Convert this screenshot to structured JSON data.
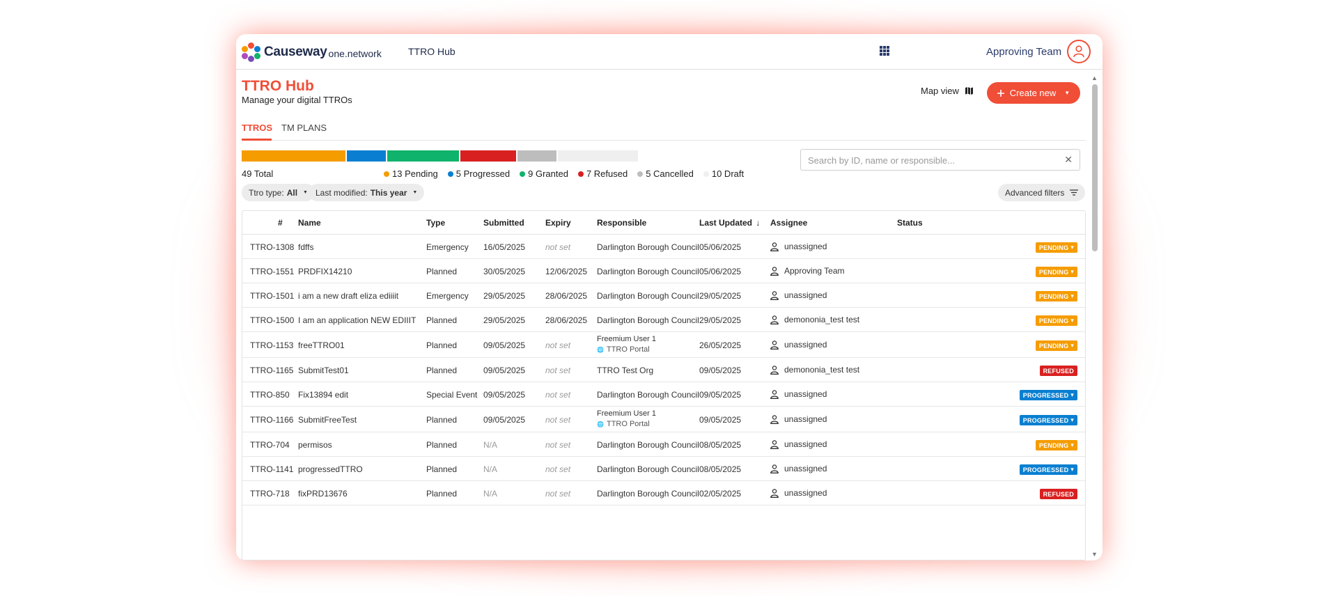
{
  "app": {
    "brand": "Causeway",
    "brand_sub": "one.network",
    "nav_link": "TTRO Hub",
    "user_label": "Approving Team"
  },
  "header": {
    "title": "TTRO Hub",
    "subtitle": "Manage your digital TTROs",
    "map_view": "Map view",
    "create_new": "Create new"
  },
  "tabs": [
    {
      "label": "TTROS",
      "active": true
    },
    {
      "label": "TM PLANS",
      "active": false
    }
  ],
  "summary": {
    "total": "49 Total",
    "segments": [
      {
        "label": "13 Pending",
        "count": 13,
        "color": "#f59c00"
      },
      {
        "label": "5 Progressed",
        "count": 5,
        "color": "#0a7fd1"
      },
      {
        "label": "9 Granted",
        "count": 9,
        "color": "#0fb36b"
      },
      {
        "label": "7 Refused",
        "count": 7,
        "color": "#d92020"
      },
      {
        "label": "5 Cancelled",
        "count": 5,
        "color": "#bdbdbd"
      },
      {
        "label": "10 Draft",
        "count": 10,
        "color": "#efefef"
      }
    ]
  },
  "search": {
    "placeholder": "Search by ID, name or responsible...",
    "value": ""
  },
  "filters": {
    "ttro_type_label": "Ttro type:",
    "ttro_type_value": "All",
    "last_modified_label": "Last modified:",
    "last_modified_value": "This year",
    "advanced": "Advanced filters"
  },
  "table": {
    "columns": [
      "#",
      "Name",
      "Type",
      "Submitted",
      "Expiry",
      "Responsible",
      "Last Updated",
      "Assignee",
      "Status"
    ],
    "rows": [
      {
        "id": "TTRO-1308",
        "name": "fdffs",
        "type": "Emergency",
        "submitted": "16/05/2025",
        "expiry": "not set",
        "responsible": "Darlington Borough Council",
        "responsible_sub": "",
        "updated": "05/06/2025",
        "assignee": "unassigned",
        "status": "PENDING"
      },
      {
        "id": "TTRO-1551",
        "name": "PRDFIX14210",
        "type": "Planned",
        "submitted": "30/05/2025",
        "expiry": "12/06/2025",
        "responsible": "Darlington Borough Council",
        "responsible_sub": "",
        "updated": "05/06/2025",
        "assignee": "Approving Team",
        "status": "PENDING"
      },
      {
        "id": "TTRO-1501",
        "name": "i am a new draft eliza ediiiit",
        "type": "Emergency",
        "submitted": "29/05/2025",
        "expiry": "28/06/2025",
        "responsible": "Darlington Borough Council",
        "responsible_sub": "",
        "updated": "29/05/2025",
        "assignee": "unassigned",
        "status": "PENDING"
      },
      {
        "id": "TTRO-1500",
        "name": "I am an application NEW EDIIIT",
        "type": "Planned",
        "submitted": "29/05/2025",
        "expiry": "28/06/2025",
        "responsible": "Darlington Borough Council",
        "responsible_sub": "",
        "updated": "29/05/2025",
        "assignee": "demononia_test test",
        "status": "PENDING"
      },
      {
        "id": "TTRO-1153",
        "name": "freeTTRO01",
        "type": "Planned",
        "submitted": "09/05/2025",
        "expiry": "not set",
        "responsible": "Freemium User 1",
        "responsible_sub": "TTRO Portal",
        "updated": "26/05/2025",
        "assignee": "unassigned",
        "status": "PENDING"
      },
      {
        "id": "TTRO-1165",
        "name": "SubmitTest01",
        "type": "Planned",
        "submitted": "09/05/2025",
        "expiry": "not set",
        "responsible": "TTRO Test Org",
        "responsible_sub": "",
        "updated": "09/05/2025",
        "assignee": "demononia_test test",
        "status": "REFUSED"
      },
      {
        "id": "TTRO-850",
        "name": "Fix13894 edit",
        "type": "Special Event",
        "submitted": "09/05/2025",
        "expiry": "not set",
        "responsible": "Darlington Borough Council",
        "responsible_sub": "",
        "updated": "09/05/2025",
        "assignee": "unassigned",
        "status": "PROGRESSED"
      },
      {
        "id": "TTRO-1166",
        "name": "SubmitFreeTest",
        "type": "Planned",
        "submitted": "09/05/2025",
        "expiry": "not set",
        "responsible": "Freemium User 1",
        "responsible_sub": "TTRO Portal",
        "updated": "09/05/2025",
        "assignee": "unassigned",
        "status": "PROGRESSED"
      },
      {
        "id": "TTRO-704",
        "name": "permisos",
        "type": "Planned",
        "submitted": "N/A",
        "expiry": "not set",
        "responsible": "Darlington Borough Council",
        "responsible_sub": "",
        "updated": "08/05/2025",
        "assignee": "unassigned",
        "status": "PENDING"
      },
      {
        "id": "TTRO-1141",
        "name": "progressedTTRO",
        "type": "Planned",
        "submitted": "N/A",
        "expiry": "not set",
        "responsible": "Darlington Borough Council",
        "responsible_sub": "",
        "updated": "08/05/2025",
        "assignee": "unassigned",
        "status": "PROGRESSED"
      },
      {
        "id": "TTRO-718",
        "name": "fixPRD13676",
        "type": "Planned",
        "submitted": "N/A",
        "expiry": "not set",
        "responsible": "Darlington Borough Council",
        "responsible_sub": "",
        "updated": "02/05/2025",
        "assignee": "unassigned",
        "status": "REFUSED"
      }
    ]
  },
  "status_colors": {
    "PENDING": "#f59c00",
    "PROGRESSED": "#0a7fd1",
    "REFUSED": "#d92020"
  },
  "icons": {
    "grid": "apps-grid-icon",
    "avatar": "user-icon",
    "map": "map-icon",
    "plus": "plus-icon",
    "close": "close-icon",
    "sort": "sort-arrow-icon",
    "filter": "filter-lines-icon",
    "globe": "globe-icon"
  }
}
